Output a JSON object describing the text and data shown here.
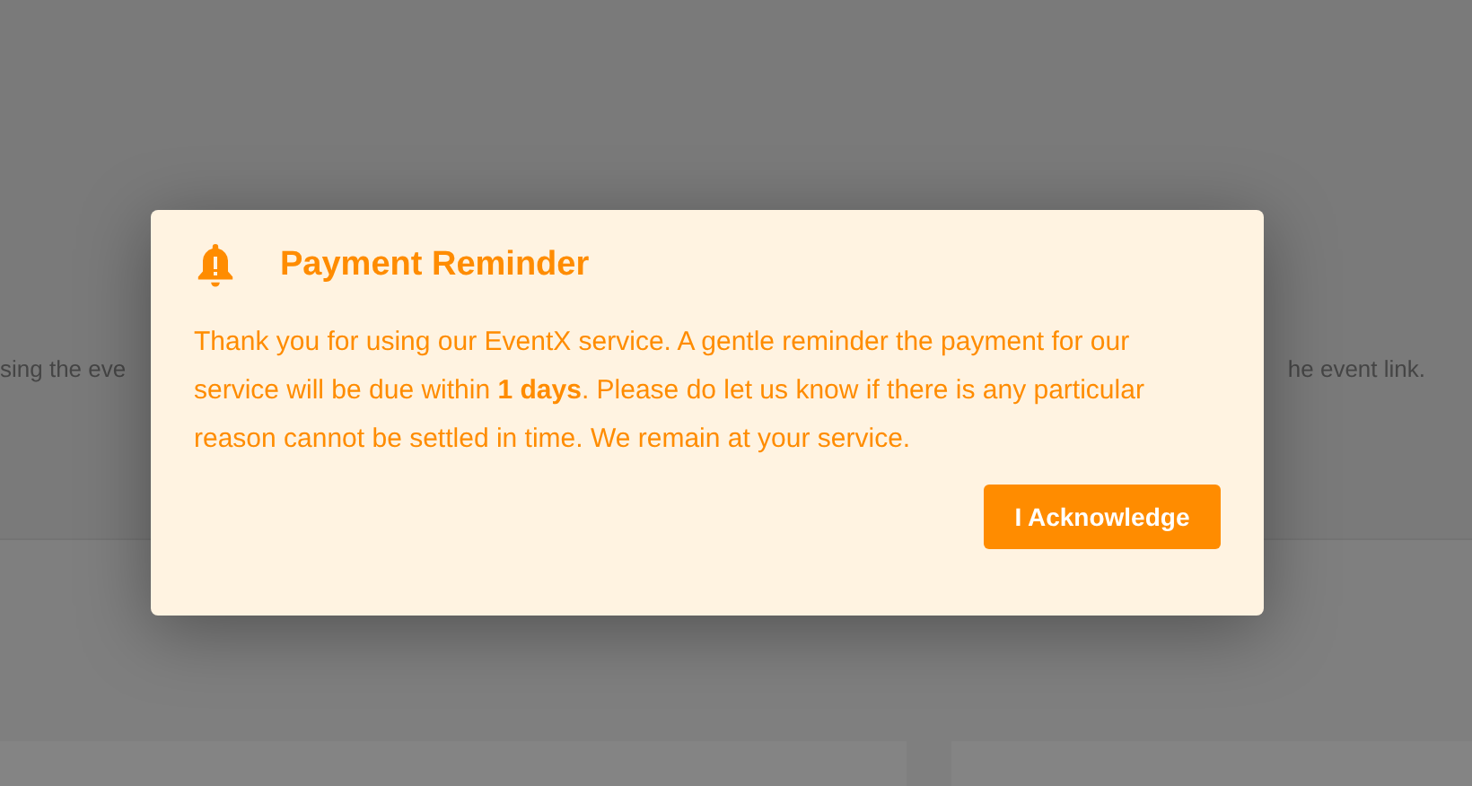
{
  "background": {
    "left_text": "sing the eve",
    "right_text": "he event link."
  },
  "dialog": {
    "title": "Payment Reminder",
    "message": "Thank you for using our EventX service. A gentle reminder the payment for our service will be due within **1 days**. Please do let us know if there is any particular reason cannot be settled in time. We remain at your service.",
    "button": "I Acknowledge"
  }
}
